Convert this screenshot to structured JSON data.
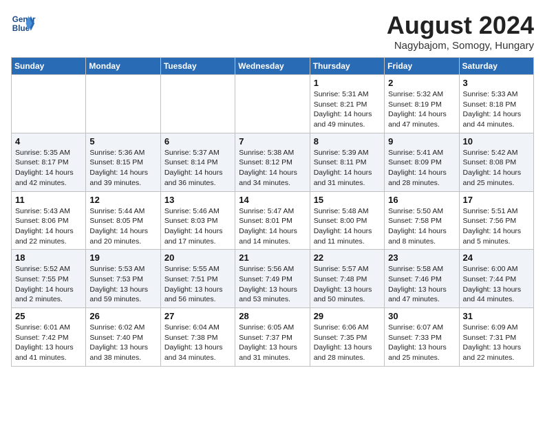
{
  "header": {
    "logo_line1": "General",
    "logo_line2": "Blue",
    "month": "August 2024",
    "location": "Nagybajom, Somogy, Hungary"
  },
  "weekdays": [
    "Sunday",
    "Monday",
    "Tuesday",
    "Wednesday",
    "Thursday",
    "Friday",
    "Saturday"
  ],
  "weeks": [
    [
      {
        "day": "",
        "sunrise": "",
        "sunset": "",
        "daylight": ""
      },
      {
        "day": "",
        "sunrise": "",
        "sunset": "",
        "daylight": ""
      },
      {
        "day": "",
        "sunrise": "",
        "sunset": "",
        "daylight": ""
      },
      {
        "day": "",
        "sunrise": "",
        "sunset": "",
        "daylight": ""
      },
      {
        "day": "1",
        "sunrise": "Sunrise: 5:31 AM",
        "sunset": "Sunset: 8:21 PM",
        "daylight": "Daylight: 14 hours and 49 minutes."
      },
      {
        "day": "2",
        "sunrise": "Sunrise: 5:32 AM",
        "sunset": "Sunset: 8:19 PM",
        "daylight": "Daylight: 14 hours and 47 minutes."
      },
      {
        "day": "3",
        "sunrise": "Sunrise: 5:33 AM",
        "sunset": "Sunset: 8:18 PM",
        "daylight": "Daylight: 14 hours and 44 minutes."
      }
    ],
    [
      {
        "day": "4",
        "sunrise": "Sunrise: 5:35 AM",
        "sunset": "Sunset: 8:17 PM",
        "daylight": "Daylight: 14 hours and 42 minutes."
      },
      {
        "day": "5",
        "sunrise": "Sunrise: 5:36 AM",
        "sunset": "Sunset: 8:15 PM",
        "daylight": "Daylight: 14 hours and 39 minutes."
      },
      {
        "day": "6",
        "sunrise": "Sunrise: 5:37 AM",
        "sunset": "Sunset: 8:14 PM",
        "daylight": "Daylight: 14 hours and 36 minutes."
      },
      {
        "day": "7",
        "sunrise": "Sunrise: 5:38 AM",
        "sunset": "Sunset: 8:12 PM",
        "daylight": "Daylight: 14 hours and 34 minutes."
      },
      {
        "day": "8",
        "sunrise": "Sunrise: 5:39 AM",
        "sunset": "Sunset: 8:11 PM",
        "daylight": "Daylight: 14 hours and 31 minutes."
      },
      {
        "day": "9",
        "sunrise": "Sunrise: 5:41 AM",
        "sunset": "Sunset: 8:09 PM",
        "daylight": "Daylight: 14 hours and 28 minutes."
      },
      {
        "day": "10",
        "sunrise": "Sunrise: 5:42 AM",
        "sunset": "Sunset: 8:08 PM",
        "daylight": "Daylight: 14 hours and 25 minutes."
      }
    ],
    [
      {
        "day": "11",
        "sunrise": "Sunrise: 5:43 AM",
        "sunset": "Sunset: 8:06 PM",
        "daylight": "Daylight: 14 hours and 22 minutes."
      },
      {
        "day": "12",
        "sunrise": "Sunrise: 5:44 AM",
        "sunset": "Sunset: 8:05 PM",
        "daylight": "Daylight: 14 hours and 20 minutes."
      },
      {
        "day": "13",
        "sunrise": "Sunrise: 5:46 AM",
        "sunset": "Sunset: 8:03 PM",
        "daylight": "Daylight: 14 hours and 17 minutes."
      },
      {
        "day": "14",
        "sunrise": "Sunrise: 5:47 AM",
        "sunset": "Sunset: 8:01 PM",
        "daylight": "Daylight: 14 hours and 14 minutes."
      },
      {
        "day": "15",
        "sunrise": "Sunrise: 5:48 AM",
        "sunset": "Sunset: 8:00 PM",
        "daylight": "Daylight: 14 hours and 11 minutes."
      },
      {
        "day": "16",
        "sunrise": "Sunrise: 5:50 AM",
        "sunset": "Sunset: 7:58 PM",
        "daylight": "Daylight: 14 hours and 8 minutes."
      },
      {
        "day": "17",
        "sunrise": "Sunrise: 5:51 AM",
        "sunset": "Sunset: 7:56 PM",
        "daylight": "Daylight: 14 hours and 5 minutes."
      }
    ],
    [
      {
        "day": "18",
        "sunrise": "Sunrise: 5:52 AM",
        "sunset": "Sunset: 7:55 PM",
        "daylight": "Daylight: 14 hours and 2 minutes."
      },
      {
        "day": "19",
        "sunrise": "Sunrise: 5:53 AM",
        "sunset": "Sunset: 7:53 PM",
        "daylight": "Daylight: 13 hours and 59 minutes."
      },
      {
        "day": "20",
        "sunrise": "Sunrise: 5:55 AM",
        "sunset": "Sunset: 7:51 PM",
        "daylight": "Daylight: 13 hours and 56 minutes."
      },
      {
        "day": "21",
        "sunrise": "Sunrise: 5:56 AM",
        "sunset": "Sunset: 7:49 PM",
        "daylight": "Daylight: 13 hours and 53 minutes."
      },
      {
        "day": "22",
        "sunrise": "Sunrise: 5:57 AM",
        "sunset": "Sunset: 7:48 PM",
        "daylight": "Daylight: 13 hours and 50 minutes."
      },
      {
        "day": "23",
        "sunrise": "Sunrise: 5:58 AM",
        "sunset": "Sunset: 7:46 PM",
        "daylight": "Daylight: 13 hours and 47 minutes."
      },
      {
        "day": "24",
        "sunrise": "Sunrise: 6:00 AM",
        "sunset": "Sunset: 7:44 PM",
        "daylight": "Daylight: 13 hours and 44 minutes."
      }
    ],
    [
      {
        "day": "25",
        "sunrise": "Sunrise: 6:01 AM",
        "sunset": "Sunset: 7:42 PM",
        "daylight": "Daylight: 13 hours and 41 minutes."
      },
      {
        "day": "26",
        "sunrise": "Sunrise: 6:02 AM",
        "sunset": "Sunset: 7:40 PM",
        "daylight": "Daylight: 13 hours and 38 minutes."
      },
      {
        "day": "27",
        "sunrise": "Sunrise: 6:04 AM",
        "sunset": "Sunset: 7:38 PM",
        "daylight": "Daylight: 13 hours and 34 minutes."
      },
      {
        "day": "28",
        "sunrise": "Sunrise: 6:05 AM",
        "sunset": "Sunset: 7:37 PM",
        "daylight": "Daylight: 13 hours and 31 minutes."
      },
      {
        "day": "29",
        "sunrise": "Sunrise: 6:06 AM",
        "sunset": "Sunset: 7:35 PM",
        "daylight": "Daylight: 13 hours and 28 minutes."
      },
      {
        "day": "30",
        "sunrise": "Sunrise: 6:07 AM",
        "sunset": "Sunset: 7:33 PM",
        "daylight": "Daylight: 13 hours and 25 minutes."
      },
      {
        "day": "31",
        "sunrise": "Sunrise: 6:09 AM",
        "sunset": "Sunset: 7:31 PM",
        "daylight": "Daylight: 13 hours and 22 minutes."
      }
    ]
  ]
}
